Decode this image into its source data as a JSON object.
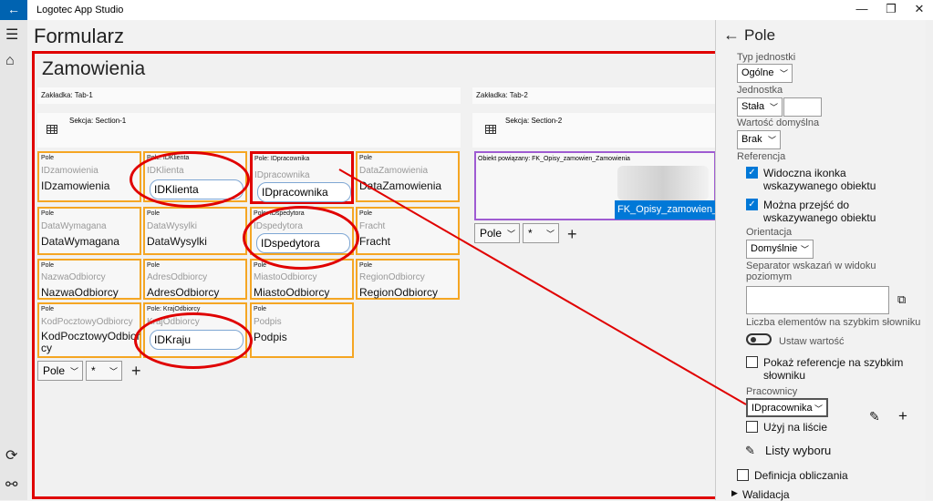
{
  "window": {
    "title": "Logotec App Studio",
    "back": "←",
    "minimize": "—",
    "maximize": "❐",
    "close": "✕"
  },
  "nav": {
    "menu": "☰",
    "home": "⌂",
    "sync": "⟳",
    "plugin": "⚯"
  },
  "page": {
    "title": "Formularz",
    "form_name": "Zamowienia"
  },
  "tabs": [
    {
      "label": "Zakładka: Tab-1",
      "section": "Sekcja: Section-1"
    },
    {
      "label": "Zakładka: Tab-2",
      "section": "Sekcja: Section-2"
    }
  ],
  "fields": [
    {
      "cap": "Pole",
      "ph": "IDzamowienia",
      "val": "IDzamowienia"
    },
    {
      "cap": "Pole: IDKlienta",
      "ph": "IDKlienta",
      "val": "IDKlienta"
    },
    {
      "cap": "Pole: IDpracownika",
      "ph": "IDpracownika",
      "val": "IDpracownika"
    },
    {
      "cap": "Pole",
      "ph": "DataZamowienia",
      "val": "DataZamowienia"
    },
    {
      "cap": "Pole",
      "ph": "DataWymagana",
      "val": "DataWymagana"
    },
    {
      "cap": "Pole",
      "ph": "DataWysylki",
      "val": "DataWysylki"
    },
    {
      "cap": "Pole: IDspedytora",
      "ph": "IDspedytora",
      "val": "IDspedytora"
    },
    {
      "cap": "Pole",
      "ph": "Fracht",
      "val": "Fracht"
    },
    {
      "cap": "Pole",
      "ph": "NazwaOdbiorcy",
      "val": "NazwaOdbiorcy"
    },
    {
      "cap": "Pole",
      "ph": "AdresOdbiorcy",
      "val": "AdresOdbiorcy"
    },
    {
      "cap": "Pole",
      "ph": "MiastoOdbiorcy",
      "val": "MiastoOdbiorcy"
    },
    {
      "cap": "Pole",
      "ph": "RegionOdbiorcy",
      "val": "RegionOdbiorcy"
    },
    {
      "cap": "Pole",
      "ph": "KodPocztowyOdbiorcy",
      "val": "KodPocztowyOdbiorcy"
    },
    {
      "cap": "Pole: KrajOdbiorcy",
      "ph": "KrajOdbiorcy",
      "val": "IDKraju"
    },
    {
      "cap": "Pole",
      "ph": "Podpis",
      "val": "Podpis"
    }
  ],
  "add_row": {
    "type": "Pole",
    "scope": "*",
    "plus": "+"
  },
  "related": {
    "cap": "Obiekt powiązany: FK_Opisy_zamowien_Zamowienia",
    "button": "FK_Opisy_zamowien_Zamowienia"
  },
  "panel": {
    "back": "←",
    "title": "Pole",
    "typ_label": "Typ jednostki",
    "typ_value": "Ogólne",
    "jedn_label": "Jednostka",
    "jedn_value": "Stała",
    "wart_label": "Wartość domyślna",
    "wart_value": "Brak",
    "ref_label": "Referencja",
    "chk1": "Widoczna ikonka wskazywanego obiektu",
    "chk2": "Można przejść do wskazywanego obiektu",
    "orient_label": "Orientacja",
    "orient_value": "Domyślnie",
    "sep_label": "Separator wskazań w widoku poziomym",
    "liczba_label": "Liczba elementów na szybkim słowniku",
    "ustaw": "Ustaw wartość",
    "pokaz": "Pokaż referencje na szybkim słowniku",
    "prac_label": "Pracownicy",
    "prac_value": "IDpracownika",
    "uzyj": "Użyj na liście",
    "listy": "Listy wyboru",
    "definicja": "Definicja obliczania",
    "walidacja": "Walidacja"
  }
}
